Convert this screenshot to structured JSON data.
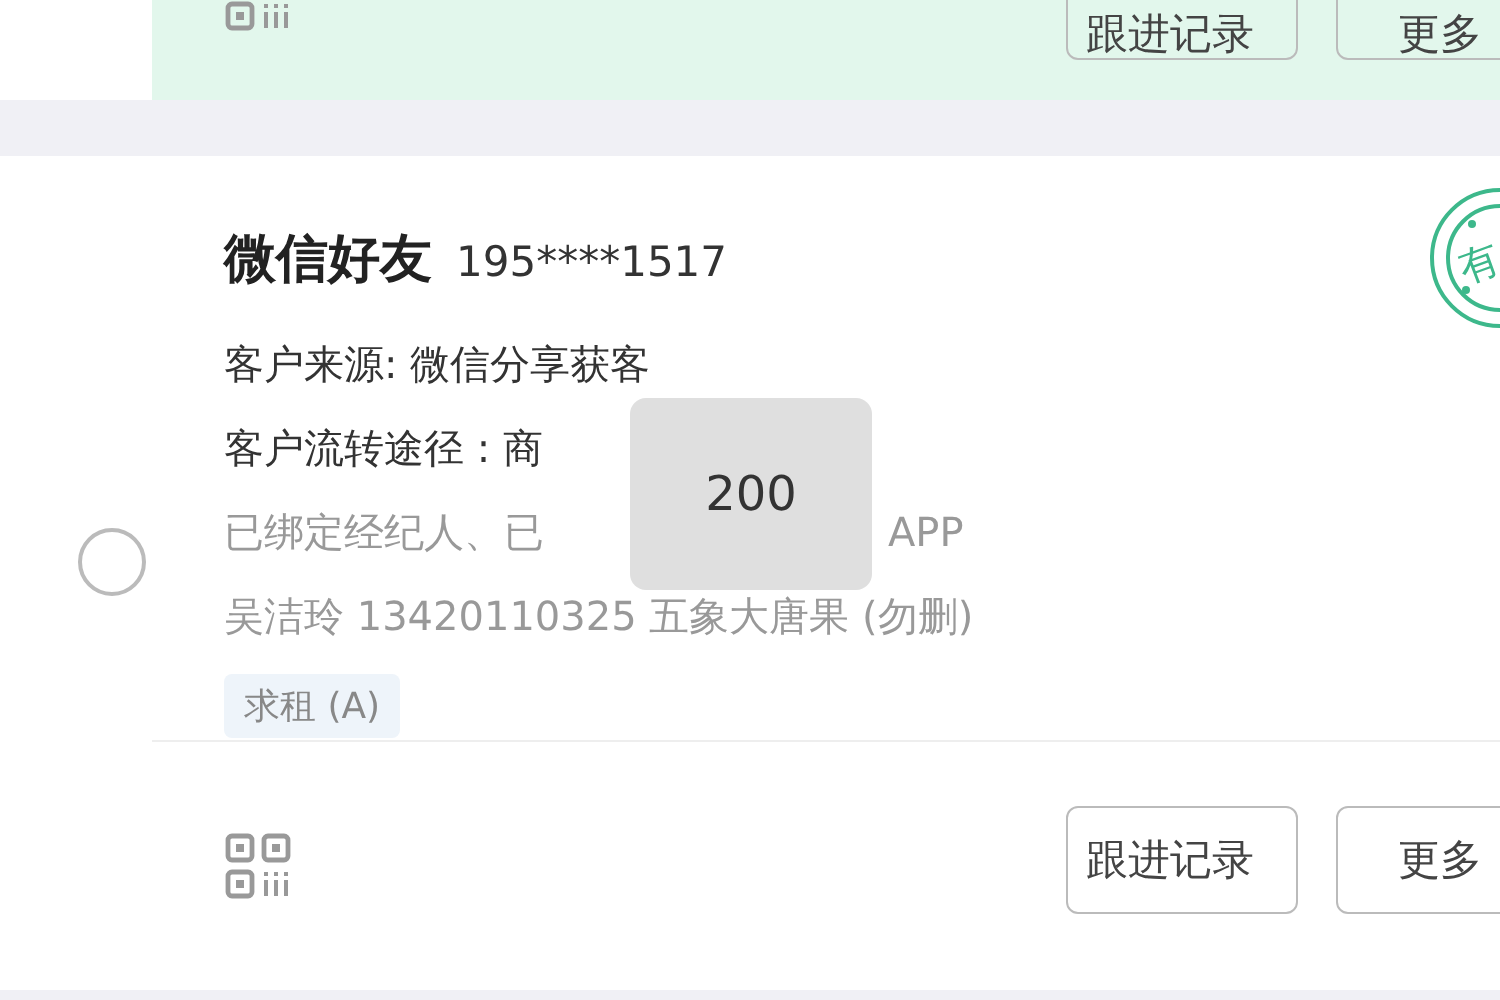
{
  "top_card": {
    "buttons": [
      "跟进记录",
      "更多"
    ]
  },
  "card": {
    "title": "微信好友",
    "phone": "195****1517",
    "selected": false,
    "stamp": "有",
    "lines": [
      {
        "kind": "dark",
        "text": "客户来源: 微信分享获客"
      },
      {
        "kind": "dark",
        "text": "客户流转途径 : 商"
      },
      {
        "kind": "muted",
        "text": "已绑定经纪人、已",
        "tail": "APP"
      },
      {
        "kind": "muted",
        "text": "吴洁玲 13420110325 五象大唐果 (勿删)"
      }
    ],
    "tag": "求租 (A)",
    "buttons": [
      "跟进记录",
      "更多"
    ]
  },
  "toast": "200"
}
